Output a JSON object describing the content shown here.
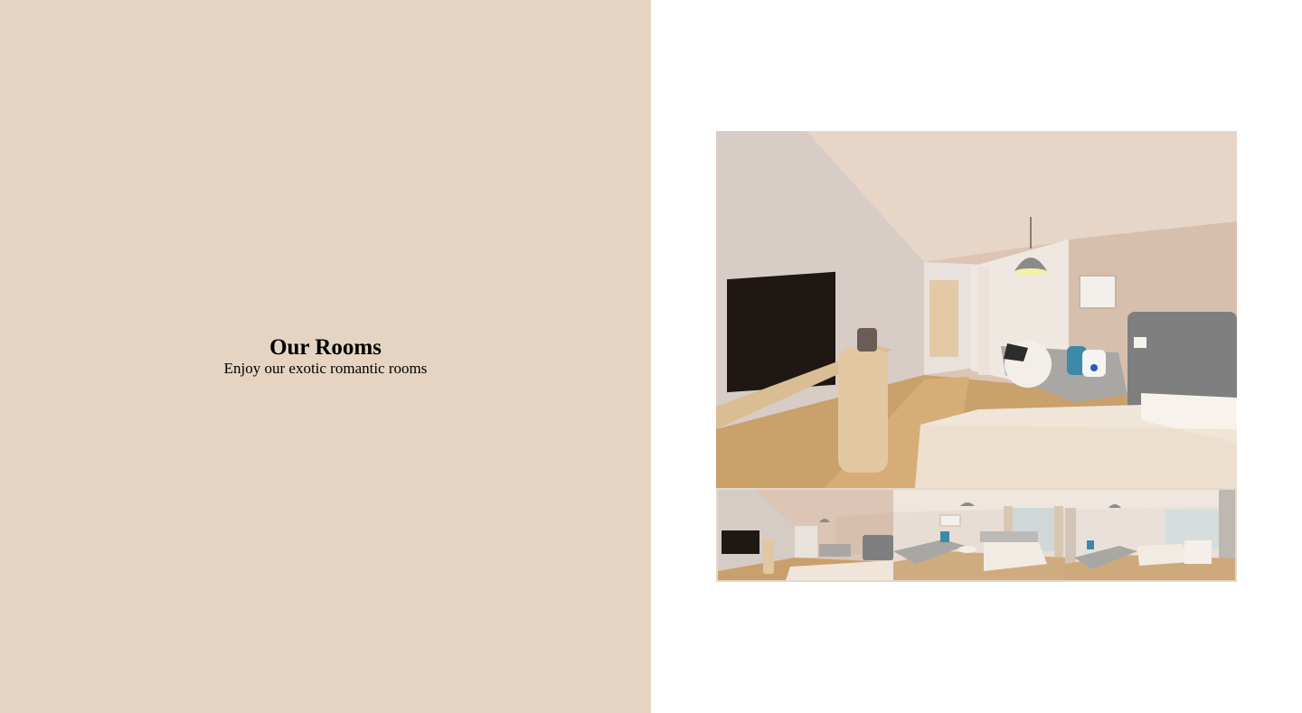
{
  "section": {
    "title": "Our Rooms",
    "subtitle": "Enjoy our exotic romantic rooms"
  },
  "gallery": {
    "main_image": "hotel-room-photo",
    "thumbnails": [
      "hotel-room-thumbnail-1",
      "hotel-room-thumbnail-2",
      "hotel-room-thumbnail-3"
    ]
  },
  "colors": {
    "left_panel_bg": "#e4d4c1",
    "right_panel_bg": "#ffffff",
    "text": "#000000"
  }
}
